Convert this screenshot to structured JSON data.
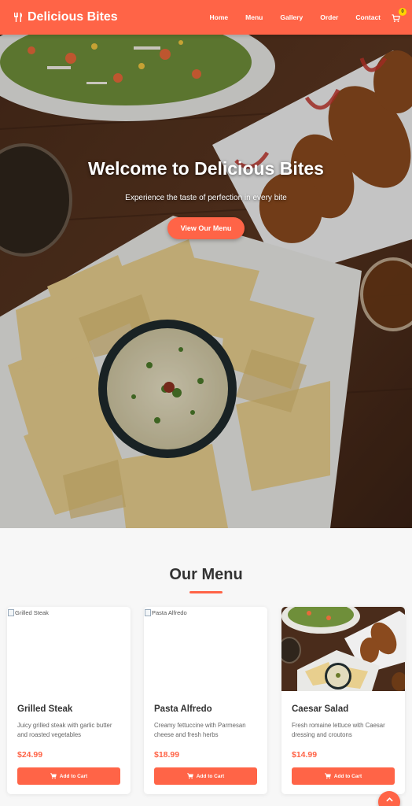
{
  "brand": {
    "name": "Delicious Bites",
    "icon": "utensils-icon"
  },
  "nav": {
    "items": [
      "Home",
      "Menu",
      "Gallery",
      "Order",
      "Contact"
    ],
    "cart_count": "0",
    "cart_icon": "shopping-cart-icon"
  },
  "hero": {
    "title": "Welcome to Delicious Bites",
    "subtitle": "Experience the taste of perfection in every bite",
    "cta": "View Our Menu"
  },
  "menu": {
    "heading": "Our Menu",
    "items": [
      {
        "image_alt": "Grilled Steak",
        "name": "Grilled Steak",
        "description": "Juicy grilled steak with garlic butter and roasted vegetables",
        "price": "$24.99",
        "button": "Add to Cart"
      },
      {
        "image_alt": "Pasta Alfredo",
        "name": "Pasta Alfredo",
        "description": "Creamy fettuccine with Parmesan cheese and fresh herbs",
        "price": "$18.99",
        "button": "Add to Cart"
      },
      {
        "image_alt": "Caesar Salad",
        "name": "Caesar Salad",
        "description": "Fresh romaine lettuce with Caesar dressing and croutons",
        "price": "$14.99",
        "button": "Add to Cart"
      }
    ]
  },
  "colors": {
    "accent": "#ff6447",
    "badge": "#ffd400",
    "text": "#333333"
  }
}
